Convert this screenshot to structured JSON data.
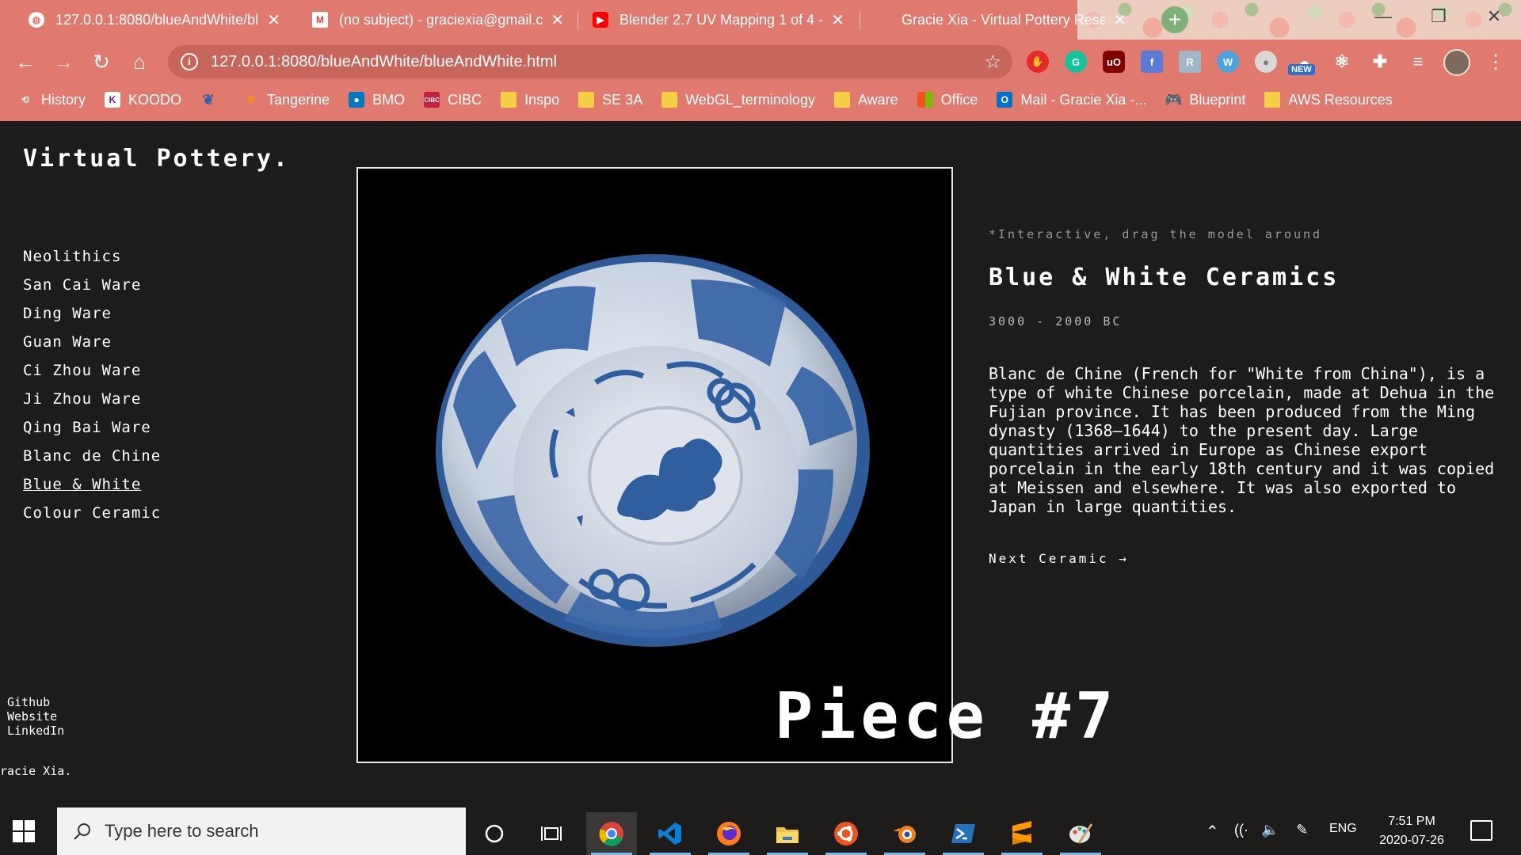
{
  "browser": {
    "tabs": [
      {
        "title": "127.0.0.1:8080/blueAndWhite/bl",
        "close": "✕",
        "active": true
      },
      {
        "title": "(no subject) - graciexia@gmail.co",
        "close": "✕",
        "active": false
      },
      {
        "title": "Blender 2.7 UV Mapping 1 of 4 -",
        "close": "✕",
        "active": false
      },
      {
        "title": "Gracie Xia - Virtual Pottery Resea",
        "close": "✕",
        "active": false
      }
    ],
    "new_tab": "+",
    "url": "127.0.0.1:8080/blueAndWhite/blueAndWhite.html",
    "extension_badge": "NEW",
    "bookmarks": [
      {
        "label": "History",
        "icon": "history-icon"
      },
      {
        "label": "KOODO",
        "icon": "koodo-icon"
      },
      {
        "label": "",
        "icon": "wolf-icon"
      },
      {
        "label": "Tangerine",
        "icon": "tangerine-icon"
      },
      {
        "label": "BMO",
        "icon": "bmo-icon"
      },
      {
        "label": "CIBC",
        "icon": "cibc-icon"
      },
      {
        "label": "Inspo",
        "icon": "folder-icon"
      },
      {
        "label": "SE 3A",
        "icon": "folder-icon"
      },
      {
        "label": "WebGL_terminology",
        "icon": "folder-icon"
      },
      {
        "label": "Aware",
        "icon": "folder-icon"
      },
      {
        "label": "Office",
        "icon": "office-icon"
      },
      {
        "label": "Mail - Gracie Xia -...",
        "icon": "outlook-icon"
      },
      {
        "label": "Blueprint",
        "icon": "gamepad-icon"
      },
      {
        "label": "AWS Resources",
        "icon": "folder-icon"
      }
    ]
  },
  "site": {
    "title": "Virtual Pottery.",
    "nav": [
      "Neolithics",
      "San Cai Ware",
      "Ding Ware",
      "Guan Ware",
      "Ci Zhou Ware",
      "Ji Zhou Ware",
      "Qing Bai Ware",
      "Blanc de Chine",
      "Blue & White",
      "Colour Ceramic"
    ],
    "current_nav": "Blue & White",
    "footer_links": [
      "Github",
      "Website",
      "LinkedIn"
    ],
    "credit": "racie Xia.",
    "piece_label": "Piece #7",
    "hint": "*Interactive, drag the model around",
    "ceramic_title": "Blue & White Ceramics",
    "dates": "3000 - 2000 BC",
    "description": "Blanc de Chine (French for \"White from China\"), is a type of white Chinese porcelain, made at Dehua in the Fujian province. It has been produced from the Ming dynasty (1368–1644) to the present day. Large quantities arrived in Europe as Chinese export porcelain in the early 18th century and it was copied at Meissen and elsewhere. It was also exported to Japan in large quantities.",
    "next_link": "Next Ceramic →"
  },
  "taskbar": {
    "search_placeholder": "Type here to search",
    "language": "ENG",
    "time": "7:51 PM",
    "date": "2020-07-26"
  },
  "colors": {
    "chrome": "#e07a6e",
    "page_bg": "#1c1c1c",
    "pottery_blue": "#2f5f9e",
    "pottery_white": "#d7dde6"
  }
}
